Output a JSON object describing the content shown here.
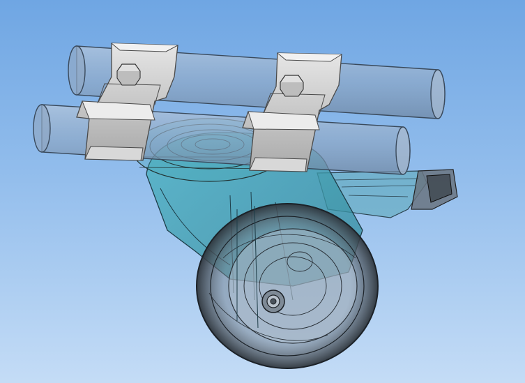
{
  "viewport": {
    "background_top": "#6fa6e3",
    "background_bottom": "#c4dcf6",
    "render_mode": "shaded-transparent-with-edges"
  },
  "model": {
    "icons": [
      "rail-tube-icon",
      "clamp-bracket-icon",
      "hex-bolt-icon",
      "swivel-plate-icon",
      "caster-fork-icon",
      "caster-wheel-icon",
      "axle-nut-icon",
      "brake-pedal-icon"
    ],
    "colors": {
      "tube": "#8fa9c8",
      "tube_edge": "#3a4a5c",
      "clamp": "#c9c9c9",
      "clamp_edge": "#4a4a4a",
      "fork": "#3ea7b8",
      "tire": "#404850",
      "hub": "#9fb3c8"
    }
  }
}
